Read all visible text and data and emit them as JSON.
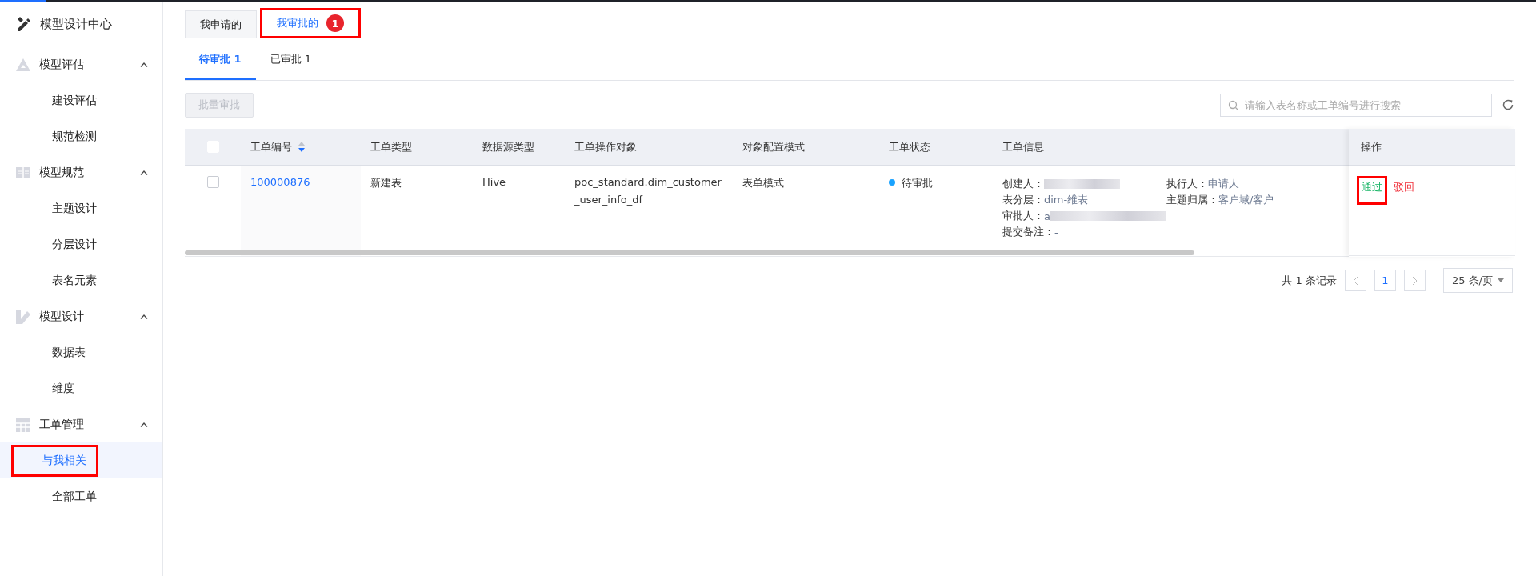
{
  "sidebar": {
    "title": "模型设计中心",
    "groups": [
      {
        "label": "模型评估",
        "expanded": true,
        "items": [
          {
            "label": "建设评估",
            "selected": false,
            "annotated": false
          },
          {
            "label": "规范检测",
            "selected": false,
            "annotated": false
          }
        ]
      },
      {
        "label": "模型规范",
        "expanded": true,
        "items": [
          {
            "label": "主题设计",
            "selected": false,
            "annotated": false
          },
          {
            "label": "分层设计",
            "selected": false,
            "annotated": false
          },
          {
            "label": "表名元素",
            "selected": false,
            "annotated": false
          }
        ]
      },
      {
        "label": "模型设计",
        "expanded": true,
        "items": [
          {
            "label": "数据表",
            "selected": false,
            "annotated": false
          },
          {
            "label": "维度",
            "selected": false,
            "annotated": false
          }
        ]
      },
      {
        "label": "工单管理",
        "expanded": true,
        "items": [
          {
            "label": "与我相关",
            "selected": true,
            "annotated": true
          },
          {
            "label": "全部工单",
            "selected": false,
            "annotated": false
          }
        ]
      }
    ]
  },
  "tabs": [
    {
      "label": "我申请的",
      "selected": false,
      "annotated": false
    },
    {
      "label": "我审批的",
      "selected": true,
      "annotated": true,
      "badge": "1"
    }
  ],
  "subtabs": [
    {
      "label": "待审批 1",
      "selected": true
    },
    {
      "label": "已审批 1",
      "selected": false
    }
  ],
  "batch_button": {
    "label": "批量审批",
    "disabled": true
  },
  "search": {
    "placeholder": "请输入表名称或工单编号进行搜索"
  },
  "table": {
    "header_checked": false,
    "columns": [
      "工单编号",
      "工单类型",
      "数据源类型",
      "工单操作对象",
      "对象配置模式",
      "工单状态",
      "工单信息",
      "操作"
    ],
    "rows": [
      {
        "checked": false,
        "id": "100000876",
        "type": "新建表",
        "source": "Hive",
        "object": "poc_standard.dim_customer_user_info_df",
        "mode": "表单模式",
        "status": {
          "label": "待审批",
          "color": "#1aa3ff"
        },
        "info_left": [
          {
            "label": "创建人：",
            "redacted": true
          },
          {
            "label": "表分层：",
            "value": "dim-维表"
          },
          {
            "label": "审批人：",
            "value": "a",
            "redacted": true
          },
          {
            "label": "提交备注：",
            "value": "-"
          }
        ],
        "info_right": [
          {
            "label": "执行人：",
            "value": "申请人"
          },
          {
            "label": "主题归属：",
            "value": "客户域/客户"
          }
        ],
        "actions": [
          {
            "label": "通过",
            "kind": "approve",
            "annotated": true
          },
          {
            "label": "驳回",
            "kind": "reject",
            "annotated": false
          }
        ]
      }
    ]
  },
  "pagination": {
    "total": "共 1 条记录",
    "pages": [
      {
        "label": "1",
        "selected": true
      }
    ],
    "page_size": "25 条/页"
  }
}
